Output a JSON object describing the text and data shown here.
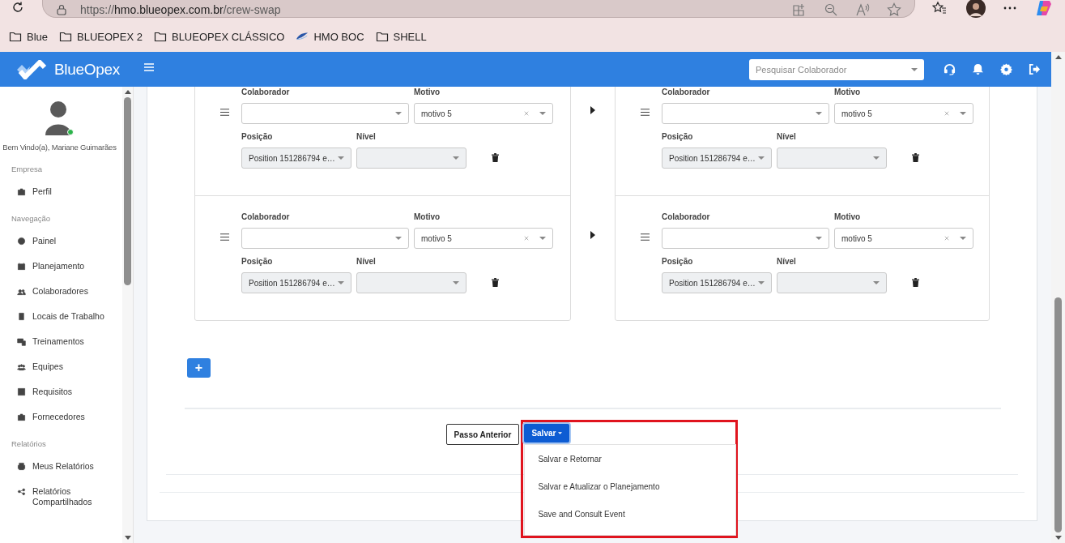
{
  "browser": {
    "address": {
      "scheme": "https://",
      "host": "hmo.blueopex.com.br",
      "path": "/crew-swap"
    },
    "bookmarks": [
      {
        "label": "Blue",
        "kind": "folder"
      },
      {
        "label": "BLUEOPEX 2",
        "kind": "folder"
      },
      {
        "label": "BLUEOPEX CLÁSSICO",
        "kind": "folder"
      },
      {
        "label": "HMO BOC",
        "kind": "site"
      },
      {
        "label": "SHELL",
        "kind": "folder"
      }
    ]
  },
  "header": {
    "logo": "BlueOpex",
    "search": {
      "placeholder": "Pesquisar Colaborador"
    }
  },
  "sidebar": {
    "user": {
      "greeting": "Bem Vindo(a), Mariane Guimarães",
      "online": true
    },
    "sections": [
      {
        "title": "Empresa",
        "items": [
          {
            "label": "Perfil"
          }
        ]
      },
      {
        "title": "Navegação",
        "items": [
          {
            "label": "Painel"
          },
          {
            "label": "Planejamento"
          },
          {
            "label": "Colaboradores"
          },
          {
            "label": "Locais de Trabalho"
          },
          {
            "label": "Treinamentos"
          },
          {
            "label": "Equipes"
          },
          {
            "label": "Requisitos"
          },
          {
            "label": "Fornecedores"
          }
        ]
      },
      {
        "title": "Relatórios",
        "items": [
          {
            "label": "Meus Relatórios"
          },
          {
            "label": "Relatórios Compartilhados"
          }
        ]
      }
    ]
  },
  "swap": {
    "panels": [
      {
        "rows": [
          {
            "colaborador": {
              "label": "Colaborador"
            },
            "motivo": {
              "label": "Motivo",
              "value": "motivo 5"
            },
            "posicao": {
              "label": "Posição",
              "value": "Position 151286794 e…",
              "disabled": true
            },
            "nivel": {
              "label": "Nível",
              "disabled": true
            }
          },
          {
            "colaborador": {
              "label": "Colaborador"
            },
            "motivo": {
              "label": "Motivo",
              "value": "motivo 5"
            },
            "posicao": {
              "label": "Posição",
              "value": "Position 151286794 e…",
              "disabled": true
            },
            "nivel": {
              "label": "Nível",
              "disabled": true
            }
          }
        ]
      },
      {
        "rows": [
          {
            "colaborador": {
              "label": "Colaborador"
            },
            "motivo": {
              "label": "Motivo",
              "value": "motivo 5"
            },
            "posicao": {
              "label": "Posição",
              "value": "Position 151286794 e…",
              "disabled": true
            },
            "nivel": {
              "label": "Nível",
              "disabled": true
            }
          },
          {
            "colaborador": {
              "label": "Colaborador"
            },
            "motivo": {
              "label": "Motivo",
              "value": "motivo 5"
            },
            "posicao": {
              "label": "Posição",
              "value": "Position 151286794 e…",
              "disabled": true
            },
            "nivel": {
              "label": "Nível",
              "disabled": true
            }
          }
        ]
      }
    ]
  },
  "add_button": {
    "label": "+"
  },
  "footer": {
    "back_button": {
      "label": "Passo Anterior"
    },
    "save": {
      "label": "Salvar",
      "expanded": true,
      "menu": [
        {
          "label": "Salvar e Retornar"
        },
        {
          "label": "Salvar e Atualizar o Planejamento"
        },
        {
          "label": "Save and Consult Event"
        }
      ]
    }
  }
}
